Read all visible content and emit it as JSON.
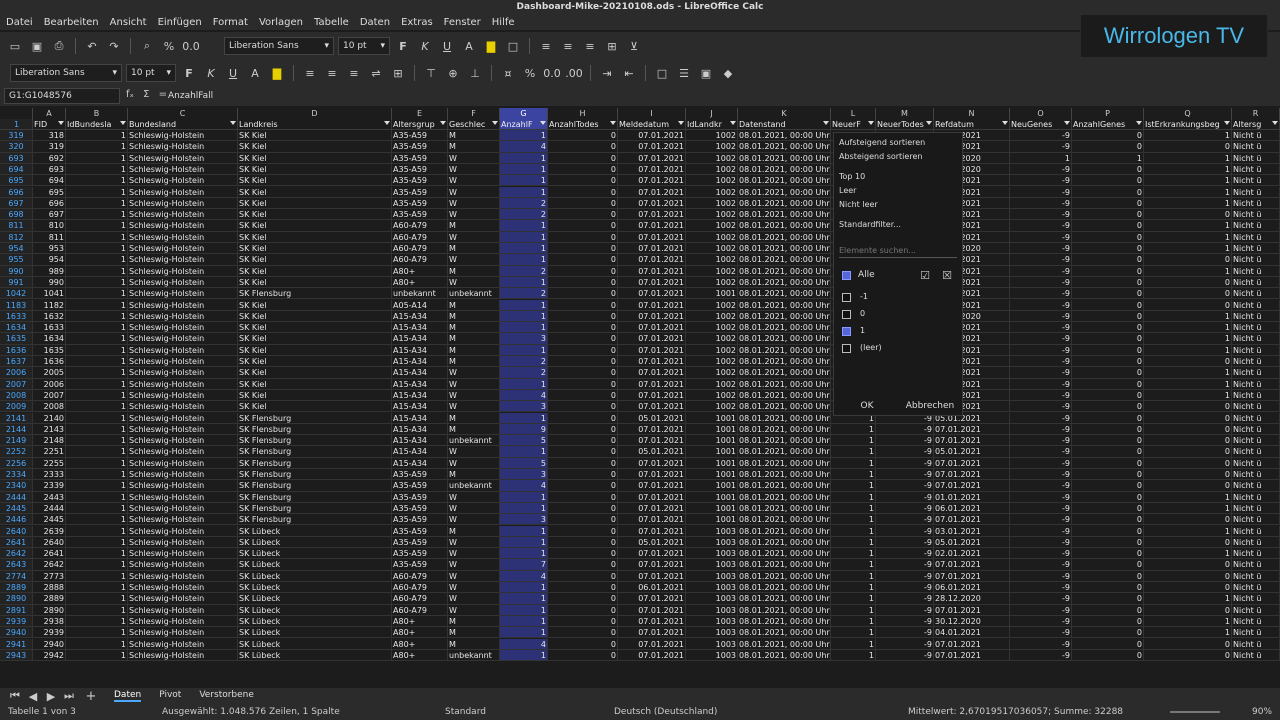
{
  "window": {
    "title": "Dashboard-Mike-20210108.ods - LibreOffice Calc"
  },
  "menu": [
    "Datei",
    "Bearbeiten",
    "Ansicht",
    "Einfügen",
    "Format",
    "Vorlagen",
    "Tabelle",
    "Daten",
    "Extras",
    "Fenster",
    "Hilfe"
  ],
  "toolbar": {
    "font1": "Liberation Sans",
    "size1": "10 pt",
    "font2": "Liberation Sans",
    "size2": "10 pt",
    "bold": "F",
    "italic": "K",
    "underline": "U"
  },
  "logo": "Wirrologen TV",
  "formulabar": {
    "namebox": "G1:G1048576",
    "content": "AnzahlFall",
    "fx": "fₓ",
    "sum": "Σ",
    "eq": "="
  },
  "columns": [
    "A",
    "B",
    "C",
    "D",
    "E",
    "F",
    "G",
    "H",
    "I",
    "J",
    "K",
    "L",
    "M",
    "N",
    "O",
    "P",
    "Q",
    "R"
  ],
  "headers": [
    "FID",
    "IdBundesla",
    "Bundesland",
    "Landkreis",
    "Altersgrup",
    "Geschlec",
    "AnzahlF",
    "AnzahlTodes",
    "Meldedatum",
    "IdLandkr",
    "Datenstand",
    "NeuerF",
    "NeuerTodes",
    "Refdatum",
    "NeuGenes",
    "AnzahlGenes",
    "IstErkrankungsbeg",
    "Altersg"
  ],
  "rows": [
    [
      "319",
      "318",
      "1",
      "Schleswig-Holstein",
      "SK Kiel",
      "A35-A59",
      "M",
      "1",
      "0",
      "07.01.2021",
      "1002",
      "08.01.2021, 00:00 Uhr",
      "",
      "",
      "04.01.2021",
      "-9",
      "0",
      "1",
      "Nicht ü"
    ],
    [
      "320",
      "319",
      "1",
      "Schleswig-Holstein",
      "SK Kiel",
      "A35-A59",
      "M",
      "4",
      "0",
      "07.01.2021",
      "1002",
      "08.01.2021, 00:00 Uhr",
      "",
      "",
      "07.01.2021",
      "-9",
      "0",
      "0",
      "Nicht ü"
    ],
    [
      "693",
      "692",
      "1",
      "Schleswig-Holstein",
      "SK Kiel",
      "A35-A59",
      "W",
      "1",
      "0",
      "07.01.2021",
      "1002",
      "08.01.2021, 00:00 Uhr",
      "",
      "",
      "01.01.2020",
      "1",
      "1",
      "1",
      "Nicht ü"
    ],
    [
      "694",
      "693",
      "1",
      "Schleswig-Holstein",
      "SK Kiel",
      "A35-A59",
      "W",
      "1",
      "0",
      "07.01.2021",
      "1002",
      "08.01.2021, 00:00 Uhr",
      "",
      "",
      "10.12.2020",
      "-9",
      "0",
      "1",
      "Nicht ü"
    ],
    [
      "695",
      "694",
      "1",
      "Schleswig-Holstein",
      "SK Kiel",
      "A35-A59",
      "W",
      "1",
      "0",
      "07.01.2021",
      "1002",
      "08.01.2021, 00:00 Uhr",
      "",
      "",
      "01.01.2021",
      "-9",
      "0",
      "1",
      "Nicht ü"
    ],
    [
      "696",
      "695",
      "1",
      "Schleswig-Holstein",
      "SK Kiel",
      "A35-A59",
      "W",
      "1",
      "0",
      "07.01.2021",
      "1002",
      "08.01.2021, 00:00 Uhr",
      "",
      "",
      "01.01.2021",
      "-9",
      "0",
      "1",
      "Nicht ü"
    ],
    [
      "697",
      "696",
      "1",
      "Schleswig-Holstein",
      "SK Kiel",
      "A35-A59",
      "W",
      "2",
      "0",
      "07.01.2021",
      "1002",
      "08.01.2021, 00:00 Uhr",
      "",
      "",
      "04.01.2021",
      "-9",
      "0",
      "1",
      "Nicht ü"
    ],
    [
      "698",
      "697",
      "1",
      "Schleswig-Holstein",
      "SK Kiel",
      "A35-A59",
      "W",
      "2",
      "0",
      "07.01.2021",
      "1002",
      "08.01.2021, 00:00 Uhr",
      "",
      "",
      "07.01.2021",
      "-9",
      "0",
      "0",
      "Nicht ü"
    ],
    [
      "811",
      "810",
      "1",
      "Schleswig-Holstein",
      "SK Kiel",
      "A60-A79",
      "M",
      "1",
      "0",
      "07.01.2021",
      "1002",
      "08.01.2021, 00:00 Uhr",
      "",
      "",
      "02.01.2021",
      "-9",
      "0",
      "1",
      "Nicht ü"
    ],
    [
      "812",
      "811",
      "1",
      "Schleswig-Holstein",
      "SK Kiel",
      "A60-A79",
      "W",
      "1",
      "0",
      "07.01.2021",
      "1002",
      "08.01.2021, 00:00 Uhr",
      "",
      "",
      "04.01.2021",
      "-9",
      "0",
      "1",
      "Nicht ü"
    ],
    [
      "954",
      "953",
      "1",
      "Schleswig-Holstein",
      "SK Kiel",
      "A60-A79",
      "M",
      "1",
      "0",
      "07.01.2021",
      "1002",
      "08.01.2021, 00:00 Uhr",
      "",
      "",
      "28.12.2020",
      "-9",
      "0",
      "1",
      "Nicht ü"
    ],
    [
      "955",
      "954",
      "1",
      "Schleswig-Holstein",
      "SK Kiel",
      "A60-A79",
      "W",
      "1",
      "0",
      "07.01.2021",
      "1002",
      "08.01.2021, 00:00 Uhr",
      "",
      "",
      "07.01.2021",
      "-9",
      "0",
      "0",
      "Nicht ü"
    ],
    [
      "990",
      "989",
      "1",
      "Schleswig-Holstein",
      "SK Kiel",
      "A80+",
      "M",
      "2",
      "0",
      "07.01.2021",
      "1002",
      "08.01.2021, 00:00 Uhr",
      "",
      "",
      "03.01.2021",
      "-9",
      "0",
      "1",
      "Nicht ü"
    ],
    [
      "991",
      "990",
      "1",
      "Schleswig-Holstein",
      "SK Kiel",
      "A80+",
      "W",
      "1",
      "0",
      "07.01.2021",
      "1002",
      "08.01.2021, 00:00 Uhr",
      "",
      "",
      "07.01.2021",
      "-9",
      "0",
      "0",
      "Nicht ü"
    ],
    [
      "1042",
      "1041",
      "1",
      "Schleswig-Holstein",
      "SK Flensburg",
      "unbekannt",
      "unbekannt",
      "2",
      "0",
      "07.01.2021",
      "1001",
      "08.01.2021, 00:00 Uhr",
      "",
      "",
      "07.01.2021",
      "-9",
      "0",
      "0",
      "Nicht ü"
    ],
    [
      "1183",
      "1182",
      "1",
      "Schleswig-Holstein",
      "SK Kiel",
      "A05-A14",
      "M",
      "1",
      "0",
      "07.01.2021",
      "1002",
      "08.01.2021, 00:00 Uhr",
      "",
      "",
      "07.01.2021",
      "-9",
      "0",
      "0",
      "Nicht ü"
    ],
    [
      "1633",
      "1632",
      "1",
      "Schleswig-Holstein",
      "SK Kiel",
      "A15-A34",
      "M",
      "1",
      "0",
      "07.01.2021",
      "1002",
      "08.01.2021, 00:00 Uhr",
      "",
      "",
      "28.12.2020",
      "-9",
      "0",
      "1",
      "Nicht ü"
    ],
    [
      "1634",
      "1633",
      "1",
      "Schleswig-Holstein",
      "SK Kiel",
      "A15-A34",
      "M",
      "1",
      "0",
      "07.01.2021",
      "1002",
      "08.01.2021, 00:00 Uhr",
      "",
      "",
      "01.01.2021",
      "-9",
      "0",
      "1",
      "Nicht ü"
    ],
    [
      "1635",
      "1634",
      "1",
      "Schleswig-Holstein",
      "SK Kiel",
      "A15-A34",
      "M",
      "3",
      "0",
      "07.01.2021",
      "1002",
      "08.01.2021, 00:00 Uhr",
      "",
      "",
      "05.01.2021",
      "-9",
      "0",
      "1",
      "Nicht ü"
    ],
    [
      "1636",
      "1635",
      "1",
      "Schleswig-Holstein",
      "SK Kiel",
      "A15-A34",
      "M",
      "1",
      "0",
      "07.01.2021",
      "1002",
      "08.01.2021, 00:00 Uhr",
      "",
      "",
      "06.01.2021",
      "-9",
      "0",
      "1",
      "Nicht ü"
    ],
    [
      "1637",
      "1636",
      "1",
      "Schleswig-Holstein",
      "SK Kiel",
      "A15-A34",
      "M",
      "2",
      "0",
      "07.01.2021",
      "1002",
      "08.01.2021, 00:00 Uhr",
      "",
      "",
      "07.01.2021",
      "-9",
      "0",
      "0",
      "Nicht ü"
    ],
    [
      "2006",
      "2005",
      "1",
      "Schleswig-Holstein",
      "SK Kiel",
      "A15-A34",
      "W",
      "2",
      "0",
      "07.01.2021",
      "1002",
      "08.01.2021, 00:00 Uhr",
      "",
      "",
      "01.01.2021",
      "-9",
      "0",
      "1",
      "Nicht ü"
    ],
    [
      "2007",
      "2006",
      "1",
      "Schleswig-Holstein",
      "SK Kiel",
      "A15-A34",
      "W",
      "1",
      "0",
      "07.01.2021",
      "1002",
      "08.01.2021, 00:00 Uhr",
      "",
      "",
      "04.01.2021",
      "-9",
      "0",
      "1",
      "Nicht ü"
    ],
    [
      "2008",
      "2007",
      "1",
      "Schleswig-Holstein",
      "SK Kiel",
      "A15-A34",
      "W",
      "4",
      "0",
      "07.01.2021",
      "1002",
      "08.01.2021, 00:00 Uhr",
      "",
      "",
      "05.01.2021",
      "-9",
      "0",
      "1",
      "Nicht ü"
    ],
    [
      "2009",
      "2008",
      "1",
      "Schleswig-Holstein",
      "SK Kiel",
      "A15-A34",
      "W",
      "3",
      "0",
      "07.01.2021",
      "1002",
      "08.01.2021, 00:00 Uhr",
      "",
      "",
      "07.01.2021",
      "-9",
      "0",
      "0",
      "Nicht ü"
    ],
    [
      "2141",
      "2140",
      "1",
      "Schleswig-Holstein",
      "SK Flensburg",
      "A15-A34",
      "M",
      "1",
      "0",
      "05.01.2021",
      "1001",
      "08.01.2021, 00:00 Uhr",
      "1",
      "-9",
      "05.01.2021",
      "-9",
      "0",
      "0",
      "Nicht ü"
    ],
    [
      "2144",
      "2143",
      "1",
      "Schleswig-Holstein",
      "SK Flensburg",
      "A15-A34",
      "M",
      "9",
      "0",
      "07.01.2021",
      "1001",
      "08.01.2021, 00:00 Uhr",
      "1",
      "-9",
      "07.01.2021",
      "-9",
      "0",
      "0",
      "Nicht ü"
    ],
    [
      "2149",
      "2148",
      "1",
      "Schleswig-Holstein",
      "SK Flensburg",
      "A15-A34",
      "unbekannt",
      "5",
      "0",
      "07.01.2021",
      "1001",
      "08.01.2021, 00:00 Uhr",
      "1",
      "-9",
      "07.01.2021",
      "-9",
      "0",
      "0",
      "Nicht ü"
    ],
    [
      "2252",
      "2251",
      "1",
      "Schleswig-Holstein",
      "SK Flensburg",
      "A15-A34",
      "W",
      "1",
      "0",
      "05.01.2021",
      "1001",
      "08.01.2021, 00:00 Uhr",
      "1",
      "-9",
      "05.01.2021",
      "-9",
      "0",
      "0",
      "Nicht ü"
    ],
    [
      "2256",
      "2255",
      "1",
      "Schleswig-Holstein",
      "SK Flensburg",
      "A15-A34",
      "W",
      "5",
      "0",
      "07.01.2021",
      "1001",
      "08.01.2021, 00:00 Uhr",
      "1",
      "-9",
      "07.01.2021",
      "-9",
      "0",
      "0",
      "Nicht ü"
    ],
    [
      "2334",
      "2333",
      "1",
      "Schleswig-Holstein",
      "SK Flensburg",
      "A35-A59",
      "M",
      "3",
      "0",
      "07.01.2021",
      "1001",
      "08.01.2021, 00:00 Uhr",
      "1",
      "-9",
      "07.01.2021",
      "-9",
      "0",
      "0",
      "Nicht ü"
    ],
    [
      "2340",
      "2339",
      "1",
      "Schleswig-Holstein",
      "SK Flensburg",
      "A35-A59",
      "unbekannt",
      "4",
      "0",
      "07.01.2021",
      "1001",
      "08.01.2021, 00:00 Uhr",
      "1",
      "-9",
      "07.01.2021",
      "-9",
      "0",
      "0",
      "Nicht ü"
    ],
    [
      "2444",
      "2443",
      "1",
      "Schleswig-Holstein",
      "SK Flensburg",
      "A35-A59",
      "W",
      "1",
      "0",
      "07.01.2021",
      "1001",
      "08.01.2021, 00:00 Uhr",
      "1",
      "-9",
      "01.01.2021",
      "-9",
      "0",
      "1",
      "Nicht ü"
    ],
    [
      "2445",
      "2444",
      "1",
      "Schleswig-Holstein",
      "SK Flensburg",
      "A35-A59",
      "W",
      "1",
      "0",
      "07.01.2021",
      "1001",
      "08.01.2021, 00:00 Uhr",
      "1",
      "-9",
      "06.01.2021",
      "-9",
      "0",
      "1",
      "Nicht ü"
    ],
    [
      "2446",
      "2445",
      "1",
      "Schleswig-Holstein",
      "SK Flensburg",
      "A35-A59",
      "W",
      "3",
      "0",
      "07.01.2021",
      "1001",
      "08.01.2021, 00:00 Uhr",
      "1",
      "-9",
      "07.01.2021",
      "-9",
      "0",
      "0",
      "Nicht ü"
    ],
    [
      "2640",
      "2639",
      "1",
      "Schleswig-Holstein",
      "SK Lübeck",
      "A35-A59",
      "M",
      "1",
      "0",
      "07.01.2021",
      "1003",
      "08.01.2021, 00:00 Uhr",
      "1",
      "-9",
      "03.01.2021",
      "-9",
      "0",
      "1",
      "Nicht ü"
    ],
    [
      "2641",
      "2640",
      "1",
      "Schleswig-Holstein",
      "SK Lübeck",
      "A35-A59",
      "W",
      "1",
      "0",
      "05.01.2021",
      "1003",
      "08.01.2021, 00:00 Uhr",
      "1",
      "-9",
      "05.01.2021",
      "-9",
      "0",
      "0",
      "Nicht ü"
    ],
    [
      "2642",
      "2641",
      "1",
      "Schleswig-Holstein",
      "SK Lübeck",
      "A35-A59",
      "W",
      "1",
      "0",
      "07.01.2021",
      "1003",
      "08.01.2021, 00:00 Uhr",
      "1",
      "-9",
      "02.01.2021",
      "-9",
      "0",
      "1",
      "Nicht ü"
    ],
    [
      "2643",
      "2642",
      "1",
      "Schleswig-Holstein",
      "SK Lübeck",
      "A35-A59",
      "W",
      "7",
      "0",
      "07.01.2021",
      "1003",
      "08.01.2021, 00:00 Uhr",
      "1",
      "-9",
      "07.01.2021",
      "-9",
      "0",
      "0",
      "Nicht ü"
    ],
    [
      "2774",
      "2773",
      "1",
      "Schleswig-Holstein",
      "SK Lübeck",
      "A60-A79",
      "W",
      "4",
      "0",
      "07.01.2021",
      "1003",
      "08.01.2021, 00:00 Uhr",
      "1",
      "-9",
      "07.01.2021",
      "-9",
      "0",
      "0",
      "Nicht ü"
    ],
    [
      "2889",
      "2888",
      "1",
      "Schleswig-Holstein",
      "SK Lübeck",
      "A60-A79",
      "W",
      "1",
      "0",
      "06.01.2021",
      "1003",
      "08.01.2021, 00:00 Uhr",
      "1",
      "-9",
      "06.01.2021",
      "-9",
      "0",
      "0",
      "Nicht ü"
    ],
    [
      "2890",
      "2889",
      "1",
      "Schleswig-Holstein",
      "SK Lübeck",
      "A60-A79",
      "W",
      "1",
      "0",
      "07.01.2021",
      "1003",
      "08.01.2021, 00:00 Uhr",
      "1",
      "-9",
      "28.12.2020",
      "-9",
      "0",
      "1",
      "Nicht ü"
    ],
    [
      "2891",
      "2890",
      "1",
      "Schleswig-Holstein",
      "SK Lübeck",
      "A60-A79",
      "W",
      "1",
      "0",
      "07.01.2021",
      "1003",
      "08.01.2021, 00:00 Uhr",
      "1",
      "-9",
      "07.01.2021",
      "-9",
      "0",
      "0",
      "Nicht ü"
    ],
    [
      "2939",
      "2938",
      "1",
      "Schleswig-Holstein",
      "SK Lübeck",
      "A80+",
      "M",
      "1",
      "0",
      "07.01.2021",
      "1003",
      "08.01.2021, 00:00 Uhr",
      "1",
      "-9",
      "30.12.2020",
      "-9",
      "0",
      "1",
      "Nicht ü"
    ],
    [
      "2940",
      "2939",
      "1",
      "Schleswig-Holstein",
      "SK Lübeck",
      "A80+",
      "M",
      "1",
      "0",
      "07.01.2021",
      "1003",
      "08.01.2021, 00:00 Uhr",
      "1",
      "-9",
      "04.01.2021",
      "-9",
      "0",
      "1",
      "Nicht ü"
    ],
    [
      "2941",
      "2940",
      "1",
      "Schleswig-Holstein",
      "SK Lübeck",
      "A80+",
      "M",
      "4",
      "0",
      "07.01.2021",
      "1003",
      "08.01.2021, 00:00 Uhr",
      "1",
      "-9",
      "07.01.2021",
      "-9",
      "0",
      "0",
      "Nicht ü"
    ],
    [
      "2943",
      "2942",
      "1",
      "Schleswig-Holstein",
      "SK Lübeck",
      "A80+",
      "unbekannt",
      "1",
      "0",
      "07.01.2021",
      "1003",
      "08.01.2021, 00:00 Uhr",
      "1",
      "-9",
      "07.01.2021",
      "-9",
      "0",
      "0",
      "Nicht ü"
    ]
  ],
  "filter_popup": {
    "sort_asc": "Aufsteigend sortieren",
    "sort_desc": "Absteigend sortieren",
    "top10": "Top 10",
    "empty": "Leer",
    "not_empty": "Nicht leer",
    "standard": "Standardfilter...",
    "search_placeholder": "Elemente suchen...",
    "all": "Alle",
    "values": [
      {
        "label": "-1",
        "checked": false
      },
      {
        "label": "0",
        "checked": false
      },
      {
        "label": "1",
        "checked": true
      },
      {
        "label": "(leer)",
        "checked": false
      }
    ],
    "ok": "OK",
    "cancel": "Abbrechen"
  },
  "sheets": [
    "Daten",
    "Pivot",
    "Verstorbene"
  ],
  "active_sheet": "Daten",
  "status": {
    "sheet": "Tabelle 1 von 3",
    "selection": "Ausgewählt: 1.048.576 Zeilen, 1 Spalte",
    "style": "Standard",
    "lang": "Deutsch (Deutschland)",
    "sum": "Mittelwert: 2,67019517036057; Summe: 32288",
    "zoom": "90%"
  },
  "colors": {
    "accent": "#4aa8ff",
    "selection": "#2c3275",
    "logo": "#49b8e8"
  }
}
